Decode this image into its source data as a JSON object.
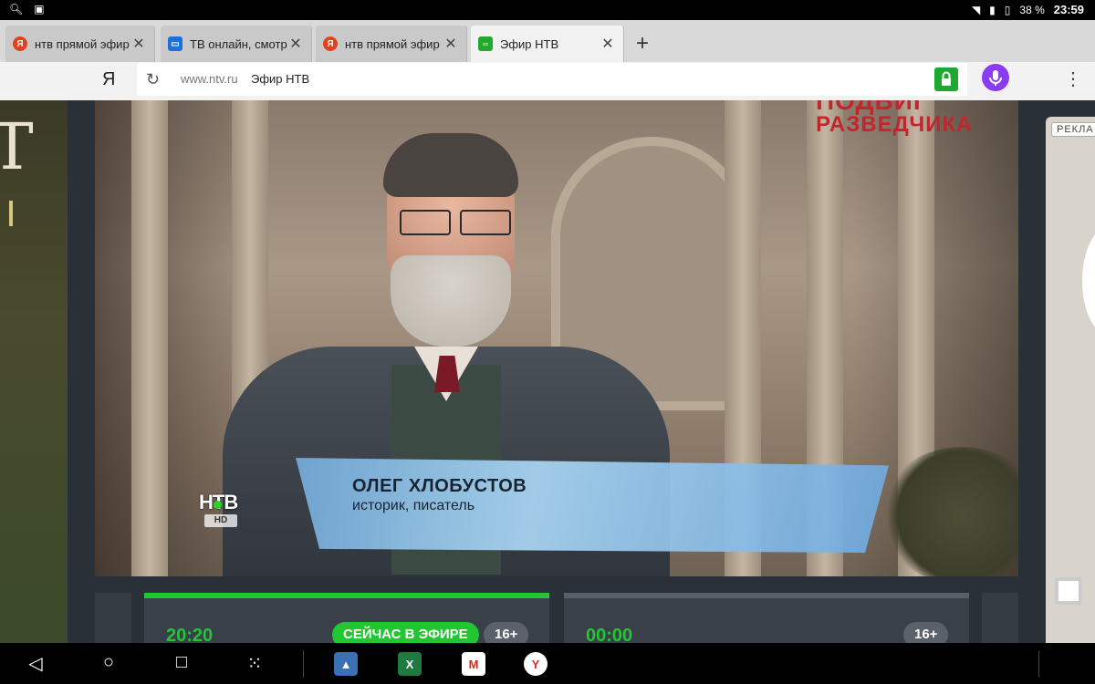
{
  "status": {
    "battery": "38 %",
    "time": "23:59"
  },
  "tabs": [
    {
      "label": "нтв прямой эфир",
      "favicon": "Я",
      "color": "#e8401c",
      "active": false
    },
    {
      "label": "ТВ онлайн, смотр",
      "favicon": "▭",
      "color": "#1e6fd9",
      "active": false
    },
    {
      "label": "нтв прямой эфир",
      "favicon": "Я",
      "color": "#e8401c",
      "active": false
    },
    {
      "label": "Эфир НТВ",
      "favicon": "НТВ",
      "color": "#22a82b",
      "active": true
    }
  ],
  "address": {
    "logo": "Я",
    "host": "www.ntv.ru",
    "title": "Эфир НТВ"
  },
  "video": {
    "show_title_line1": "ПОДВИГ",
    "show_title_line2": "РАЗВЕДЧИКА",
    "lower_third_name": "ОЛЕГ ХЛОБУСТОВ",
    "lower_third_role": "историк, писатель",
    "channel_logo": "НТВ",
    "channel_hd": "HD"
  },
  "right_ad": {
    "label": "РЕКЛА"
  },
  "schedule": {
    "current": {
      "time": "20:20",
      "live_label": "СЕЙЧАС В ЭФИРЕ",
      "age": "16+"
    },
    "next": {
      "time": "00:00",
      "age": "16+"
    }
  },
  "colors": {
    "live_green": "#22c633",
    "lock_green": "#1da831",
    "mic_purple": "#8c3cf0"
  }
}
